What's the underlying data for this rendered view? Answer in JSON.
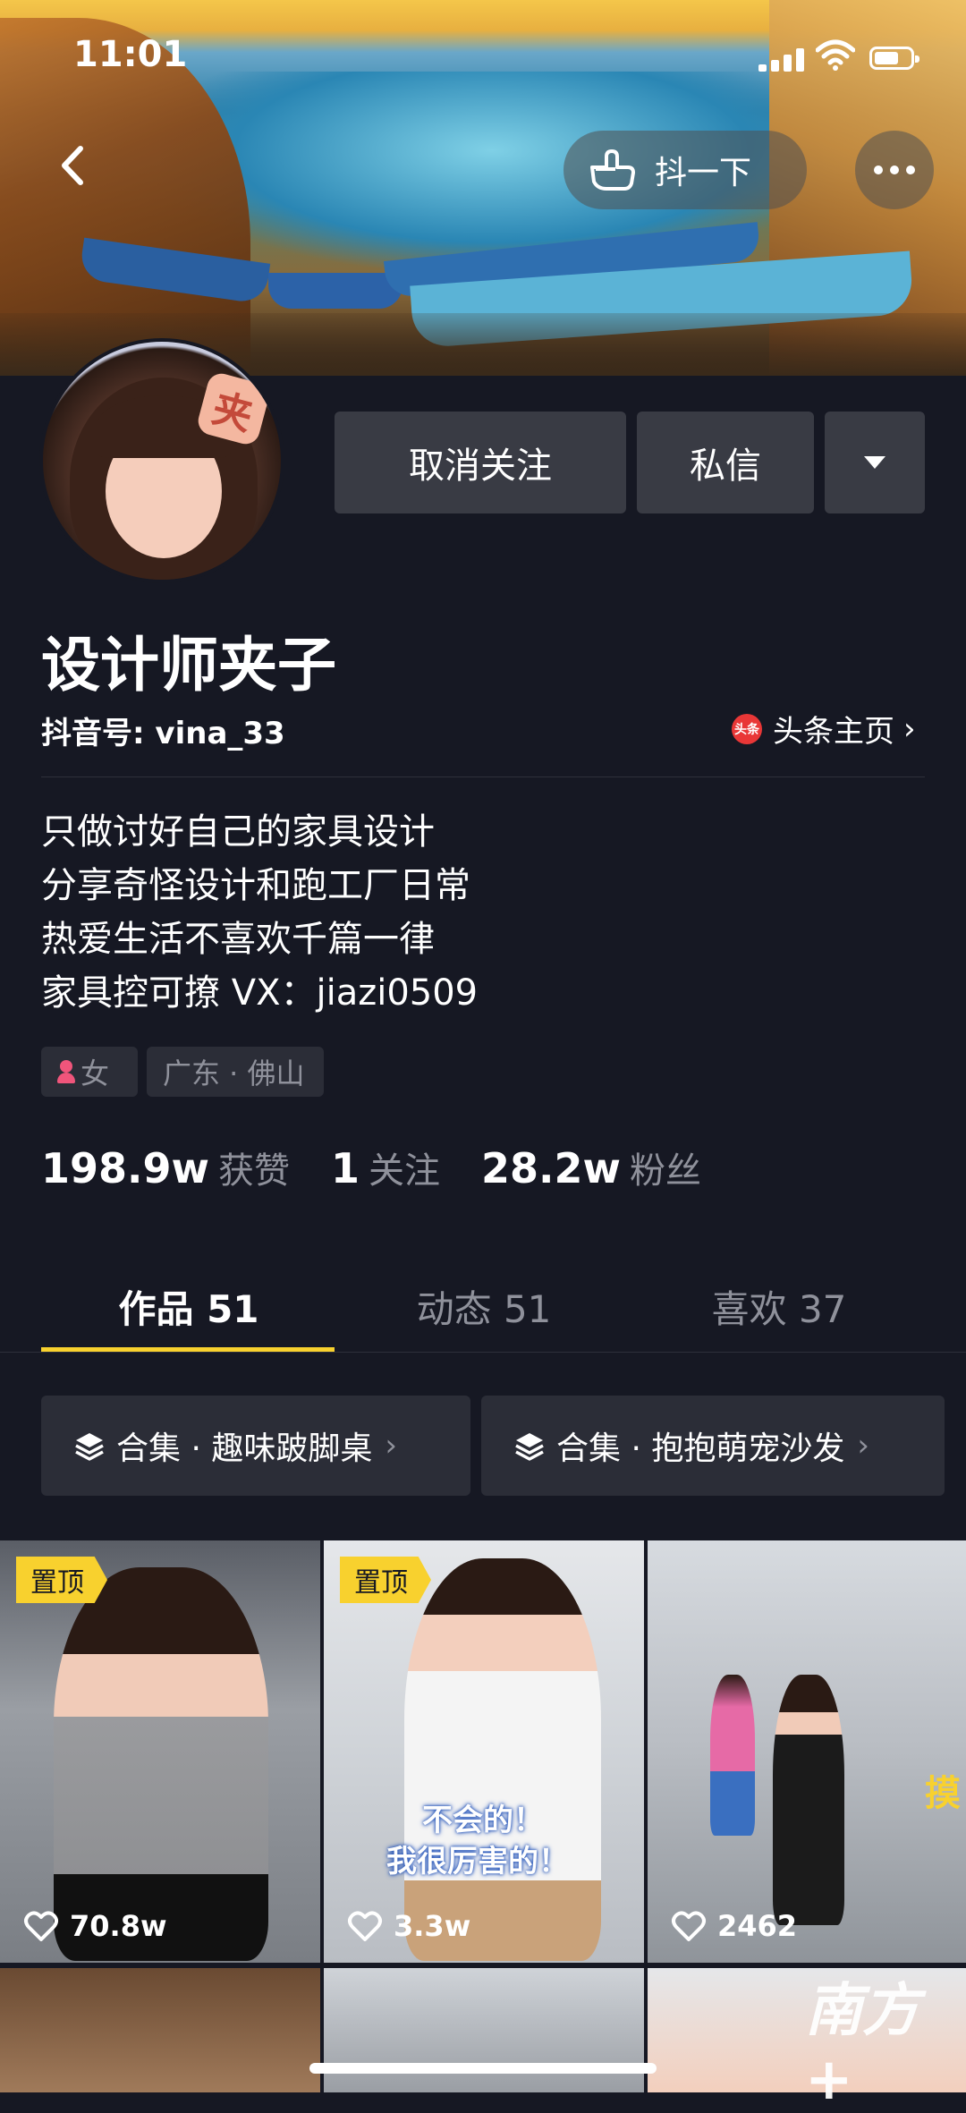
{
  "status_bar": {
    "time": "11:01"
  },
  "header": {
    "shake_label": "抖一下"
  },
  "profile": {
    "name": "设计师夹子",
    "douyin_id": "抖音号: vina_33",
    "toutiao_link": "头条主页",
    "toutiao_logo_text": "头条",
    "avatar_clip_text": "夹",
    "bio": [
      "只做讨好自己的家具设计",
      "分享奇怪设计和跑工厂日常",
      "热爱生活不喜欢千篇一律",
      "家具控可撩 VX：jiazi0509"
    ],
    "tags": {
      "gender": "女",
      "location": "广东 · 佛山"
    }
  },
  "actions": {
    "unfollow": "取消关注",
    "message": "私信"
  },
  "stats": [
    {
      "num": "198.9w",
      "label": "获赞"
    },
    {
      "num": "1",
      "label": "关注"
    },
    {
      "num": "28.2w",
      "label": "粉丝"
    }
  ],
  "tabs": [
    {
      "label": "作品 51",
      "active": true
    },
    {
      "label": "动态 51",
      "active": false
    },
    {
      "label": "喜欢 37",
      "active": false
    }
  ],
  "collections": [
    {
      "label": "合集 · 趣味跛脚桌"
    },
    {
      "label": "合集 · 抱抱萌宠沙发"
    }
  ],
  "videos": [
    {
      "pinned_label": "置顶",
      "likes": "70.8w"
    },
    {
      "pinned_label": "置顶",
      "likes": "3.3w",
      "overlay": [
        "不会的！",
        "我很厉害的！"
      ]
    },
    {
      "likes": "2462",
      "side_text": "摸"
    }
  ],
  "watermark": "南方+",
  "colors": {
    "background": "#161823",
    "accent": "#f8d12e",
    "button": "#393b44",
    "muted_text": "#8f919b"
  }
}
